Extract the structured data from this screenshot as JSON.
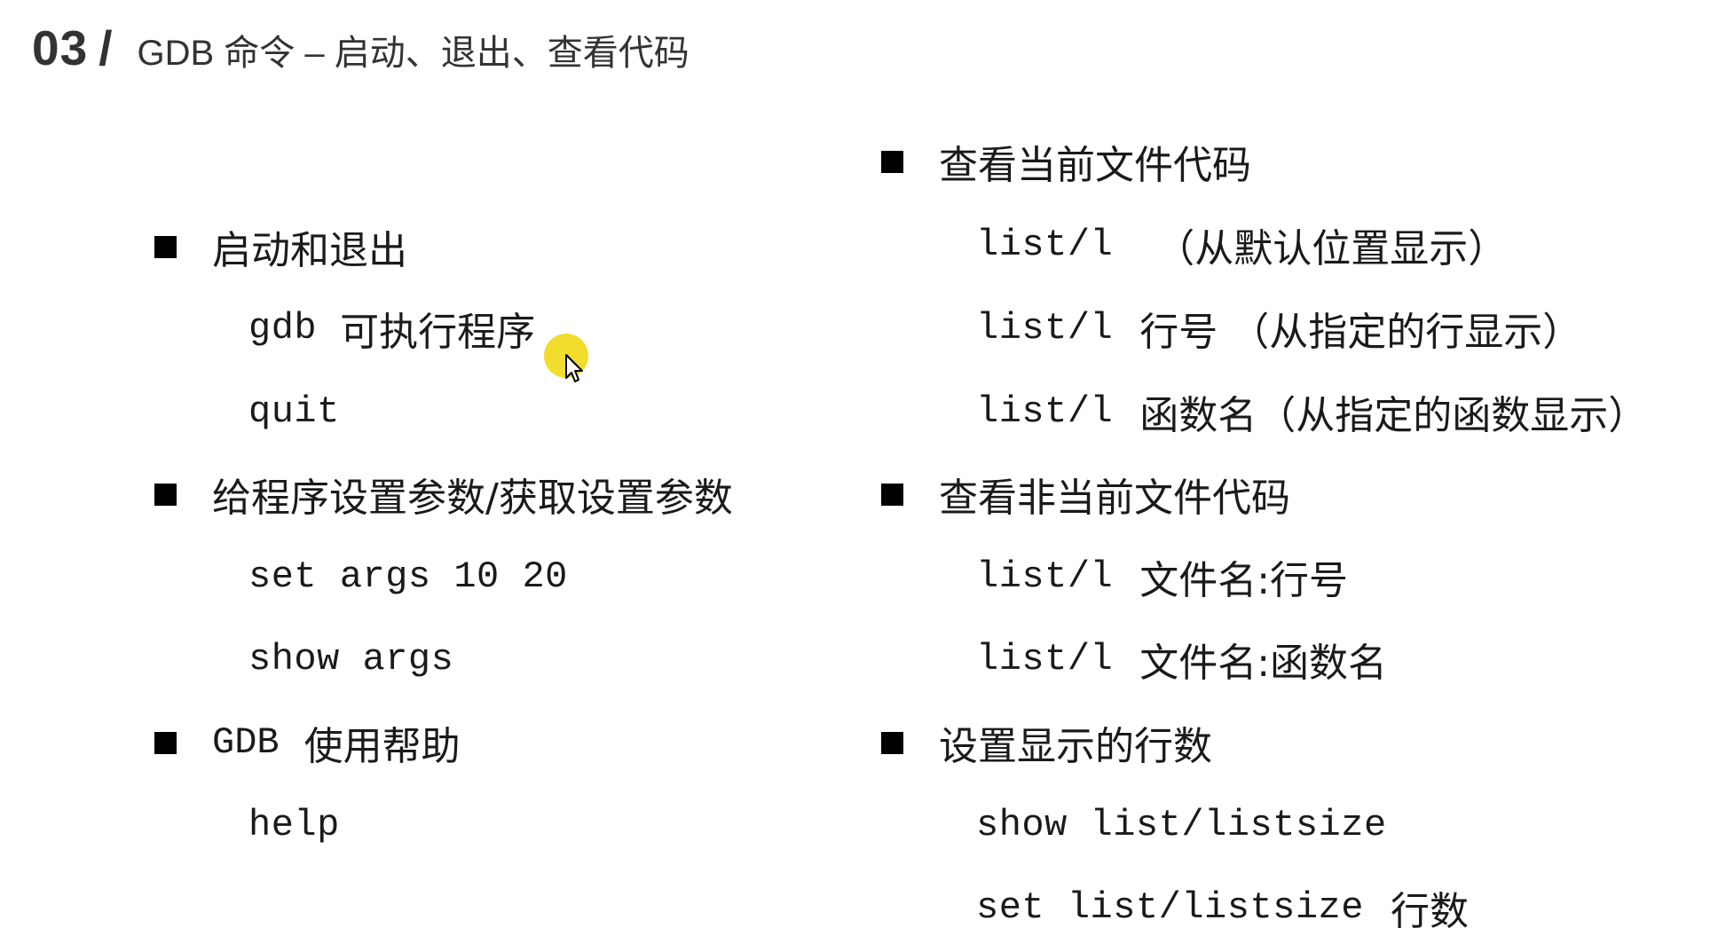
{
  "header": {
    "number": "03",
    "slash": "/",
    "title": "GDB 命令 – 启动、退出、查看代码"
  },
  "left": {
    "sections": [
      {
        "heading": "启动和退出",
        "items": [
          {
            "code": "gdb",
            "desc": "可执行程序"
          },
          {
            "code": "quit",
            "desc": ""
          }
        ]
      },
      {
        "heading": "给程序设置参数/获取设置参数",
        "items": [
          {
            "code": "set args 10 20",
            "desc": ""
          },
          {
            "code": "show args",
            "desc": ""
          }
        ]
      },
      {
        "heading_code": "GDB",
        "heading": "使用帮助",
        "items": [
          {
            "code": "help",
            "desc": ""
          }
        ]
      }
    ]
  },
  "right": {
    "sections": [
      {
        "heading": "查看当前文件代码",
        "items": [
          {
            "code": "list/l",
            "desc": "（从默认位置显示）"
          },
          {
            "code": "list/l",
            "desc": "行号 （从指定的行显示）"
          },
          {
            "code": "list/l",
            "desc": "函数名（从指定的函数显示）"
          }
        ]
      },
      {
        "heading": "查看非当前文件代码",
        "items": [
          {
            "code": "list/l",
            "desc": "文件名:行号"
          },
          {
            "code": "list/l",
            "desc": "文件名:函数名"
          }
        ]
      },
      {
        "heading": "设置显示的行数",
        "items": [
          {
            "code": "show list/listsize",
            "desc": ""
          },
          {
            "code": "set list/listsize",
            "desc": "行数"
          }
        ]
      }
    ]
  },
  "colors": {
    "text": "#1a1a1a",
    "header": "#333333",
    "bullet": "#000000",
    "cursor_highlight": "#f1da1c"
  },
  "icons": {
    "bullet": "black-square-bullet-icon",
    "cursor": "mouse-pointer-icon"
  }
}
